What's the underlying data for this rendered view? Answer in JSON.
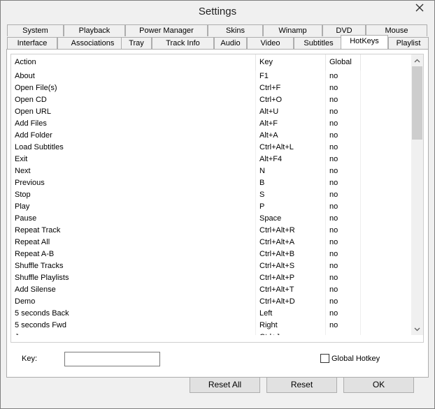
{
  "window": {
    "title": "Settings"
  },
  "tabs_row1": [
    "System",
    "Playback",
    "Power Manager",
    "Skins",
    "Winamp",
    "DVD",
    "Mouse"
  ],
  "tabs_row2": [
    "Interface",
    "Associations",
    "Tray",
    "Track Info",
    "Audio",
    "Video",
    "Subtitles",
    "HotKeys",
    "Playlist"
  ],
  "active_tab": "HotKeys",
  "table": {
    "headers": [
      "Action",
      "Key",
      "Global"
    ],
    "rows": [
      [
        "About",
        "F1",
        "no"
      ],
      [
        "Open File(s)",
        "Ctrl+F",
        "no"
      ],
      [
        "Open CD",
        "Ctrl+O",
        "no"
      ],
      [
        "Open URL",
        "Alt+U",
        "no"
      ],
      [
        "Add Files",
        "Alt+F",
        "no"
      ],
      [
        "Add Folder",
        "Alt+A",
        "no"
      ],
      [
        "Load Subtitles",
        "Ctrl+Alt+L",
        "no"
      ],
      [
        "Exit",
        "Alt+F4",
        "no"
      ],
      [
        "Next",
        "N",
        "no"
      ],
      [
        "Previous",
        "B",
        "no"
      ],
      [
        "Stop",
        "S",
        "no"
      ],
      [
        "Play",
        "P",
        "no"
      ],
      [
        "Pause",
        "Space",
        "no"
      ],
      [
        "Repeat Track",
        "Ctrl+Alt+R",
        "no"
      ],
      [
        "Repeat All",
        "Ctrl+Alt+A",
        "no"
      ],
      [
        "Repeat A-B",
        "Ctrl+Alt+B",
        "no"
      ],
      [
        "Shuffle Tracks",
        "Ctrl+Alt+S",
        "no"
      ],
      [
        "Shuffle Playlists",
        "Ctrl+Alt+P",
        "no"
      ],
      [
        "Add Silense",
        "Ctrl+Alt+T",
        "no"
      ],
      [
        "Demo",
        "Ctrl+Alt+D",
        "no"
      ],
      [
        "5 seconds Back",
        "Left",
        "no"
      ],
      [
        "5 seconds Fwd",
        "Right",
        "no"
      ],
      [
        "Jump",
        "Ctrl+J",
        "no"
      ]
    ]
  },
  "key_field": {
    "label": "Key:",
    "value": ""
  },
  "global_hotkey": {
    "label": "Global Hotkey",
    "checked": false
  },
  "buttons": {
    "reset_all": "Reset All",
    "reset": "Reset",
    "ok": "OK"
  }
}
